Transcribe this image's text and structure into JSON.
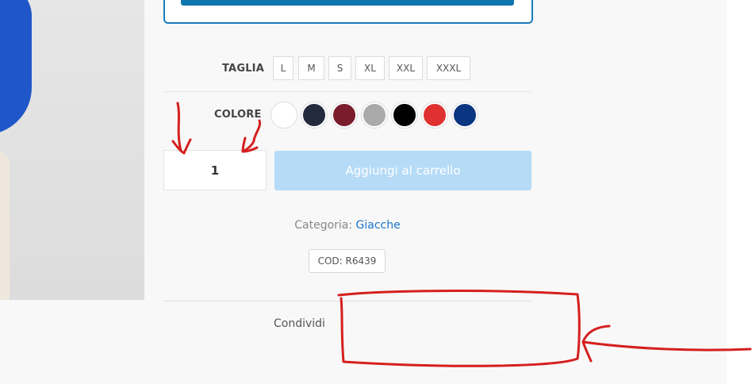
{
  "product": {
    "size_label": "TAGLIA",
    "sizes": [
      "L",
      "M",
      "S",
      "XL",
      "XXL",
      "XXXL"
    ],
    "color_label": "COLORE",
    "colors": [
      "#ffffff",
      "#232a3d",
      "#7a1c2b",
      "#aaaaaa",
      "#000000",
      "#e03131",
      "#0a3580"
    ],
    "quantity": "1",
    "add_to_cart_label": "Aggiungi al carrello",
    "accent_color": "#1a73c9",
    "add_button_color": "#b5dbf7"
  },
  "meta": {
    "category_label": "Categoria:",
    "category_value": "Giacche",
    "sku_text": "COD: R6439"
  },
  "share": {
    "label": "Condividi"
  },
  "annotation_color": "#d51f1f"
}
